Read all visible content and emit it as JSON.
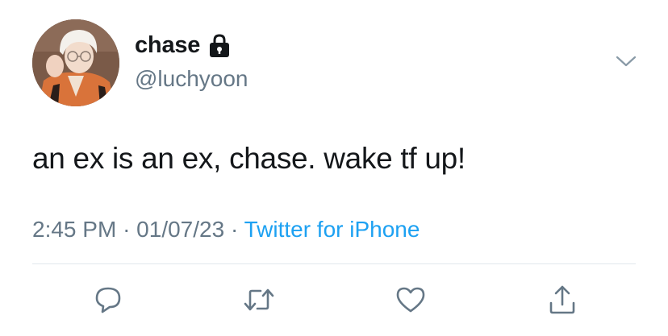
{
  "author": {
    "display_name": "chase",
    "handle": "@luchyoon",
    "protected": true,
    "lock_icon": "lock-icon",
    "avatar": "avatar"
  },
  "tweet": {
    "text": "an ex is an ex, chase. wake tf up!",
    "time": "2:45 PM",
    "separator": "·",
    "date": "01/07/23",
    "source": "Twitter for iPhone"
  },
  "colors": {
    "text_primary": "#14171a",
    "text_secondary": "#657786",
    "link": "#1da1f2",
    "divider": "#e1e8ed"
  },
  "actions": [
    {
      "name": "reply",
      "icon": "reply-icon"
    },
    {
      "name": "retweet",
      "icon": "retweet-icon"
    },
    {
      "name": "like",
      "icon": "heart-icon"
    },
    {
      "name": "share",
      "icon": "share-icon"
    }
  ],
  "menu_icon": "chevron-down-icon"
}
